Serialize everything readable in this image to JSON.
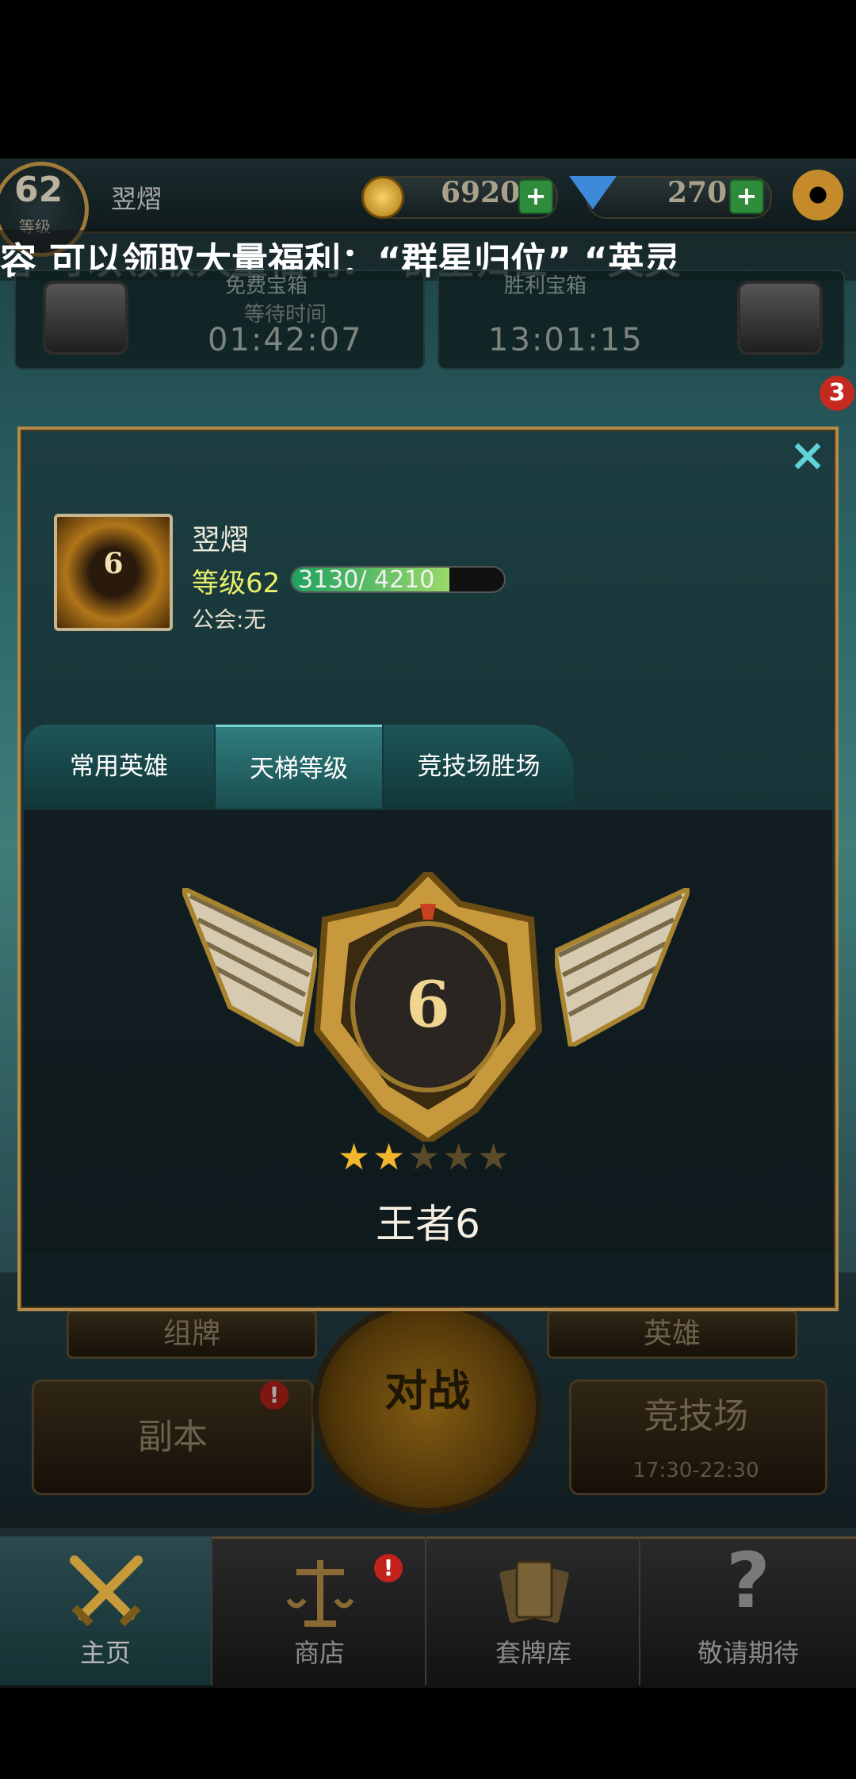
{
  "top": {
    "level_num": "62",
    "level_label": "等级",
    "player_name": "翌熠",
    "gold": "6920",
    "gems": "270",
    "plus": "+"
  },
  "marquee": "容 可以领取大量福利：“群星归位”  “英灵",
  "chests": {
    "free_title": "免费宝箱",
    "free_sub": "等待时间",
    "free_timer": "01:42:07",
    "victory_title": "胜利宝箱",
    "victory_timer": "13:01:15",
    "badge_count": "3"
  },
  "profile": {
    "close": "×",
    "name": "翌熠",
    "level_label": "等级62",
    "xp_text": "3130/ 4210",
    "xp_fraction": 0.743,
    "guild": "公会:无",
    "avatar_rank": "6"
  },
  "tabs": [
    "常用英雄",
    "天梯等级",
    "竞技场胜场"
  ],
  "active_tab": 1,
  "rank": {
    "emblem_number": "6",
    "stars_filled": 2,
    "stars_total": 5,
    "name": "王者6"
  },
  "lower": {
    "deck_btn": "组牌",
    "heroes_btn": "英雄",
    "battle": "对战",
    "dungeon": "副本",
    "arena": "竞技场",
    "arena_time": "17:30-22:30",
    "notice": "!"
  },
  "nav": [
    {
      "label": "主页"
    },
    {
      "label": "商店"
    },
    {
      "label": "套牌库"
    },
    {
      "label": "敬请期待"
    }
  ],
  "colors": {
    "accent_teal": "#5fd3d8",
    "gold": "#c7993c",
    "level_text": "#e8f06a"
  }
}
